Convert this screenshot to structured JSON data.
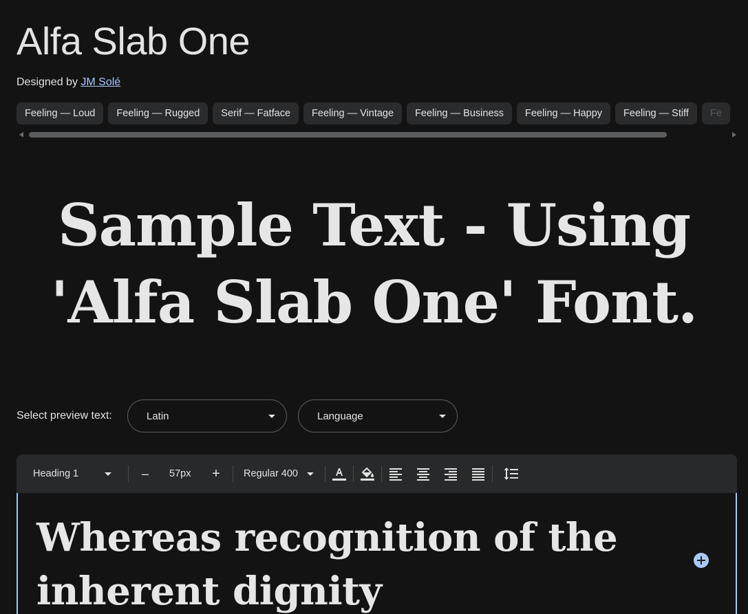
{
  "header": {
    "font_name": "Alfa Slab One",
    "designed_by_label": "Designed by",
    "designer_name": "JM Solé"
  },
  "tags": [
    "Feeling — Loud",
    "Feeling — Rugged",
    "Serif — Fatface",
    "Feeling — Vintage",
    "Feeling — Business",
    "Feeling — Happy",
    "Feeling — Stiff",
    "Fe"
  ],
  "sample": {
    "line1": "Sample Text - Using",
    "line2": "'Alfa Slab One' Font."
  },
  "preview_controls": {
    "label": "Select preview text:",
    "script_value": "Latin",
    "language_value": "Language"
  },
  "toolbar": {
    "style_value": "Heading 1",
    "size_value": "57px",
    "weight_value": "Regular 400",
    "decrease_glyph": "–",
    "increase_glyph": "+"
  },
  "editor": {
    "text": "Whereas recognition of the inherent dignity"
  },
  "colors": {
    "background": "#131314",
    "surface": "#28292a",
    "chip": "#2a2b2d",
    "accent": "#a8c7fa",
    "text": "#e3e3e3"
  },
  "icons": [
    "text-color-icon",
    "highlight-color-icon",
    "align-left-icon",
    "align-center-icon",
    "align-right-icon",
    "align-justify-icon",
    "line-height-icon",
    "add-icon"
  ]
}
